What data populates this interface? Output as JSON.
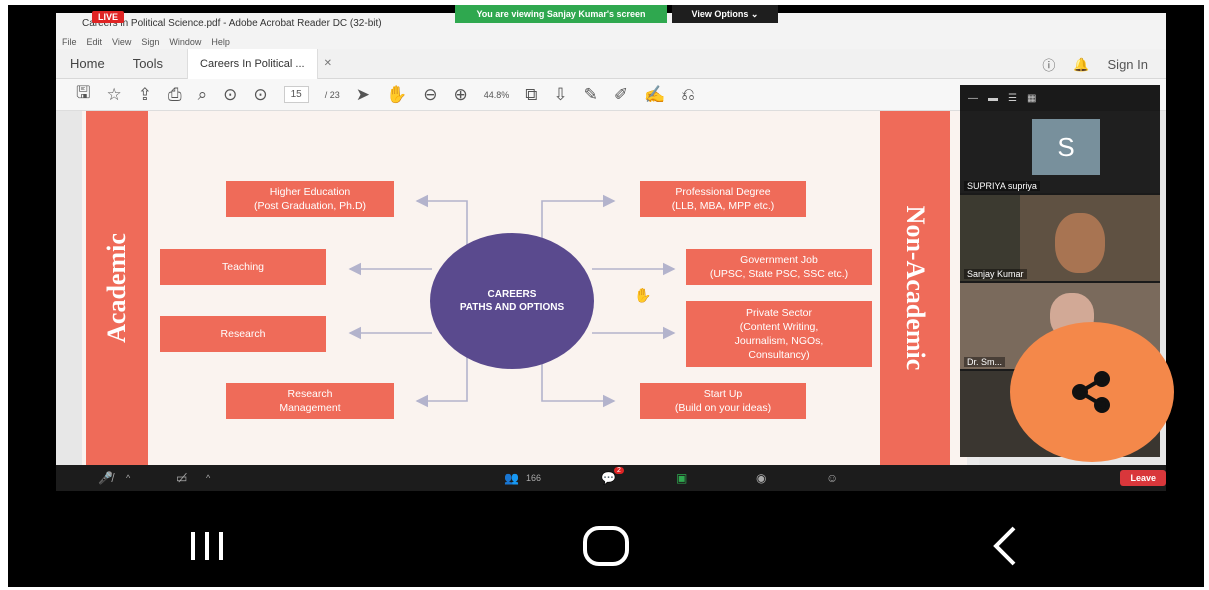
{
  "zoom": {
    "banner": "You are viewing Sanjay Kumar's screen",
    "view_options": "View Options ⌄",
    "live_badge": "LIVE",
    "leave_label": "Leave",
    "participants_count": "166",
    "chat_badge": "2",
    "participants": [
      {
        "name": "SUPRIYA supriya",
        "avatar_letter": "S"
      },
      {
        "name": "Sanjay Kumar"
      },
      {
        "name": "Dr. Sm..."
      }
    ]
  },
  "acrobat": {
    "title": "Careers in Political Science.pdf - Adobe Acrobat Reader DC (32-bit)",
    "menu": [
      "File",
      "Edit",
      "View",
      "Sign",
      "Window",
      "Help"
    ],
    "home_tab": "Home",
    "tools_tab": "Tools",
    "doc_tab": "Careers In Political ...",
    "sign_in": "Sign In",
    "page_current": "15",
    "page_total": "/ 23",
    "zoom_level": "44.8%"
  },
  "slide": {
    "left_label": "Academic",
    "right_label": "Non-Academic",
    "center": "CAREERS\nPATHS AND OPTIONS",
    "left_boxes": [
      "Higher Education\n(Post Graduation, Ph.D)",
      "Teaching",
      "Research",
      "Research\nManagement"
    ],
    "right_boxes": [
      "Professional Degree\n(LLB, MBA, MPP etc.)",
      "Government Job\n(UPSC, State PSC, SSC etc.)",
      "Private Sector\n(Content Writing,\nJournalism, NGOs,\nConsultancy)",
      "Start Up\n(Build on your ideas)"
    ]
  },
  "colors": {
    "slide_accent": "#ef6b59",
    "circle": "#5a4a8e",
    "banner_green": "#2fa84f",
    "share_fab": "#f4884a",
    "leave_red": "#d9373b"
  }
}
